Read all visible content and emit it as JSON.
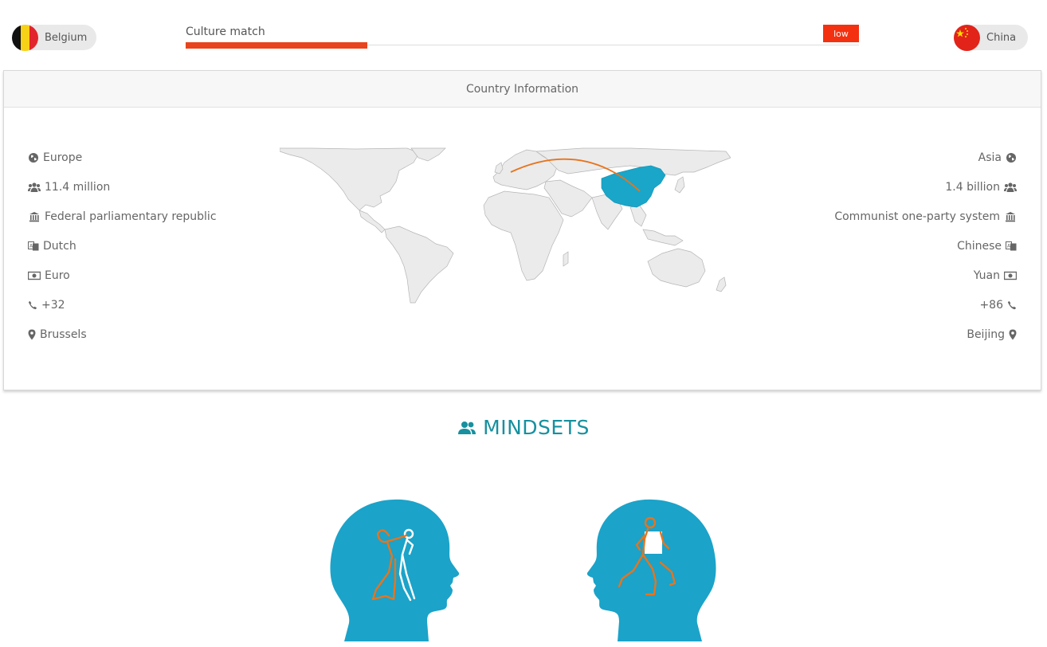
{
  "left_country": {
    "name": "Belgium"
  },
  "right_country": {
    "name": "China"
  },
  "culture_match": {
    "label": "Culture match",
    "level": "low",
    "fill_fraction": 0.27
  },
  "card": {
    "title": "Country Information"
  },
  "left_facts": [
    {
      "icon": "globe-icon",
      "text": "Europe"
    },
    {
      "icon": "people-icon",
      "text": "11.4 million"
    },
    {
      "icon": "government-icon",
      "text": "Federal parliamentary republic"
    },
    {
      "icon": "language-icon",
      "text": "Dutch"
    },
    {
      "icon": "money-icon",
      "text": "Euro"
    },
    {
      "icon": "phone-icon",
      "text": "+32"
    },
    {
      "icon": "map-marker-icon",
      "text": "Brussels"
    }
  ],
  "right_facts": [
    {
      "icon": "globe-icon",
      "text": "Asia"
    },
    {
      "icon": "people-icon",
      "text": "1.4 billion"
    },
    {
      "icon": "government-icon",
      "text": "Communist one-party system"
    },
    {
      "icon": "language-icon",
      "text": "Chinese"
    },
    {
      "icon": "money-icon",
      "text": "Yuan"
    },
    {
      "icon": "phone-icon",
      "text": "+86"
    },
    {
      "icon": "map-marker-icon",
      "text": "Beijing"
    }
  ],
  "mindsets": {
    "title": "MINDSETS"
  },
  "colors": {
    "accent": "#17909f",
    "match_bar": "#e8441d",
    "badge": "#f33110",
    "highlight_country": "#1aa6c8",
    "route": "#e8741d",
    "head": "#1ba3c9"
  }
}
